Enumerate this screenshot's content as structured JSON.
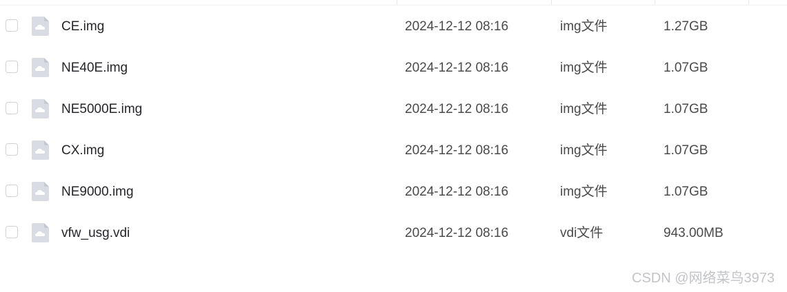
{
  "files": [
    {
      "name": "CE.img",
      "modified": "2024-12-12 08:16",
      "type": "img文件",
      "size": "1.27GB"
    },
    {
      "name": "NE40E.img",
      "modified": "2024-12-12 08:16",
      "type": "img文件",
      "size": "1.07GB"
    },
    {
      "name": "NE5000E.img",
      "modified": "2024-12-12 08:16",
      "type": "img文件",
      "size": "1.07GB"
    },
    {
      "name": "CX.img",
      "modified": "2024-12-12 08:16",
      "type": "img文件",
      "size": "1.07GB"
    },
    {
      "name": "NE9000.img",
      "modified": "2024-12-12 08:16",
      "type": "img文件",
      "size": "1.07GB"
    },
    {
      "name": "vfw_usg.vdi",
      "modified": "2024-12-12 08:16",
      "type": "vdi文件",
      "size": "943.00MB"
    }
  ],
  "file_icon": "cloud-file-icon",
  "colors": {
    "checkbox_border": "#cfd3d8",
    "icon_fill": "#d9dde3",
    "watermark": "#c2c4c8"
  },
  "watermark": "CSDN @网络菜鸟3973"
}
